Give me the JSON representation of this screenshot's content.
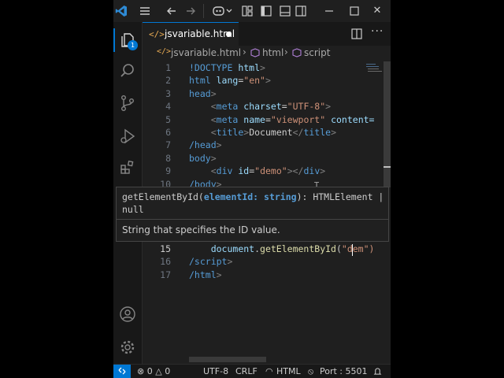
{
  "titlebar": {
    "menu_icon": "hamburger-icon",
    "back_icon": "arrow-left-icon",
    "forward_icon": "arrow-right-icon",
    "copilot_icon": "copilot-icon",
    "close_glyph": "✕"
  },
  "activity_bar": {
    "explorer_badge": "1",
    "items": [
      "explorer-icon",
      "search-icon",
      "source-control-icon",
      "run-debug-icon",
      "extensions-icon"
    ],
    "bottom_items": [
      "account-icon",
      "settings-gear-icon"
    ]
  },
  "tab": {
    "label": "jsvariable.html"
  },
  "breadcrumb": {
    "file": "jsvariable.html",
    "element": "html",
    "symbol": "script"
  },
  "editor": {
    "lines": [
      {
        "n": "1",
        "segs": [
          {
            "t": "!DOCTYPE ",
            "c": "t-tag"
          },
          {
            "t": "html",
            "c": "t-attr"
          },
          {
            "t": ">",
            "c": "t-pun"
          }
        ]
      },
      {
        "n": "2",
        "segs": [
          {
            "t": "html ",
            "c": "t-tag"
          },
          {
            "t": "lang",
            "c": "t-attr"
          },
          {
            "t": "=",
            "c": "t-txt"
          },
          {
            "t": "\"en\"",
            "c": "t-str"
          },
          {
            "t": ">",
            "c": "t-pun"
          }
        ]
      },
      {
        "n": "3",
        "segs": [
          {
            "t": "head",
            "c": "t-tag"
          },
          {
            "t": ">",
            "c": "t-pun"
          }
        ]
      },
      {
        "n": "4",
        "segs": [
          {
            "t": "    ",
            "c": "t-txt"
          },
          {
            "t": "<",
            "c": "t-pun"
          },
          {
            "t": "meta ",
            "c": "t-tag"
          },
          {
            "t": "charset",
            "c": "t-attr"
          },
          {
            "t": "=",
            "c": "t-txt"
          },
          {
            "t": "\"UTF-8\"",
            "c": "t-str"
          },
          {
            "t": ">",
            "c": "t-pun"
          }
        ]
      },
      {
        "n": "5",
        "segs": [
          {
            "t": "    ",
            "c": "t-txt"
          },
          {
            "t": "<",
            "c": "t-pun"
          },
          {
            "t": "meta ",
            "c": "t-tag"
          },
          {
            "t": "name",
            "c": "t-attr"
          },
          {
            "t": "=",
            "c": "t-txt"
          },
          {
            "t": "\"viewport\"",
            "c": "t-str"
          },
          {
            "t": " content=",
            "c": "t-attr"
          }
        ]
      },
      {
        "n": "6",
        "segs": [
          {
            "t": "    ",
            "c": "t-txt"
          },
          {
            "t": "<",
            "c": "t-pun"
          },
          {
            "t": "title",
            "c": "t-tag"
          },
          {
            "t": ">",
            "c": "t-pun"
          },
          {
            "t": "Document",
            "c": "t-txt"
          },
          {
            "t": "</",
            "c": "t-pun"
          },
          {
            "t": "title",
            "c": "t-tag"
          },
          {
            "t": ">",
            "c": "t-pun"
          }
        ]
      },
      {
        "n": "7",
        "segs": [
          {
            "t": "/head",
            "c": "t-tag"
          },
          {
            "t": ">",
            "c": "t-pun"
          }
        ]
      },
      {
        "n": "8",
        "segs": [
          {
            "t": "body",
            "c": "t-tag"
          },
          {
            "t": ">",
            "c": "t-pun"
          }
        ]
      },
      {
        "n": "9",
        "segs": [
          {
            "t": "    ",
            "c": "t-txt"
          },
          {
            "t": "<",
            "c": "t-pun"
          },
          {
            "t": "div ",
            "c": "t-tag"
          },
          {
            "t": "id",
            "c": "t-attr"
          },
          {
            "t": "=",
            "c": "t-txt"
          },
          {
            "t": "\"demo\"",
            "c": "t-str"
          },
          {
            "t": "></",
            "c": "t-pun"
          },
          {
            "t": "div",
            "c": "t-tag"
          },
          {
            "t": ">",
            "c": "t-pun"
          }
        ]
      },
      {
        "n": "10",
        "segs": [
          {
            "t": "/body",
            "c": "t-tag"
          },
          {
            "t": ">",
            "c": "t-pun"
          }
        ]
      }
    ],
    "lines_after": [
      {
        "n": "15",
        "segs": [
          {
            "t": "    ",
            "c": "t-txt"
          },
          {
            "t": "document",
            "c": "t-attr"
          },
          {
            "t": ".",
            "c": "t-txt"
          },
          {
            "t": "getElementById",
            "c": "t-fn"
          },
          {
            "t": "(",
            "c": "t-txt"
          },
          {
            "t": "\"dem",
            "c": "t-str"
          },
          {
            "t": "\")",
            "c": "t-str"
          }
        ]
      },
      {
        "n": "16",
        "segs": [
          {
            "t": "/script",
            "c": "t-tag"
          },
          {
            "t": ">",
            "c": "t-pun"
          }
        ]
      },
      {
        "n": "17",
        "segs": [
          {
            "t": "/html",
            "c": "t-tag"
          },
          {
            "t": ">",
            "c": "t-pun"
          }
        ]
      }
    ]
  },
  "hover": {
    "fn_name": "getElementById(",
    "param": "elementId: string",
    "sig_rest": "): HTMLElement |",
    "sig_line2": "null",
    "doc": "String that specifies the ID value."
  },
  "statusbar": {
    "problems": "0",
    "warnings": "0",
    "encoding": "UTF-8",
    "eol": "CRLF",
    "language": "HTML",
    "port": "Port : 5501"
  },
  "colors": {
    "accent": "#0078d4",
    "background": "#1f1f1f",
    "sidebar": "#181818"
  }
}
